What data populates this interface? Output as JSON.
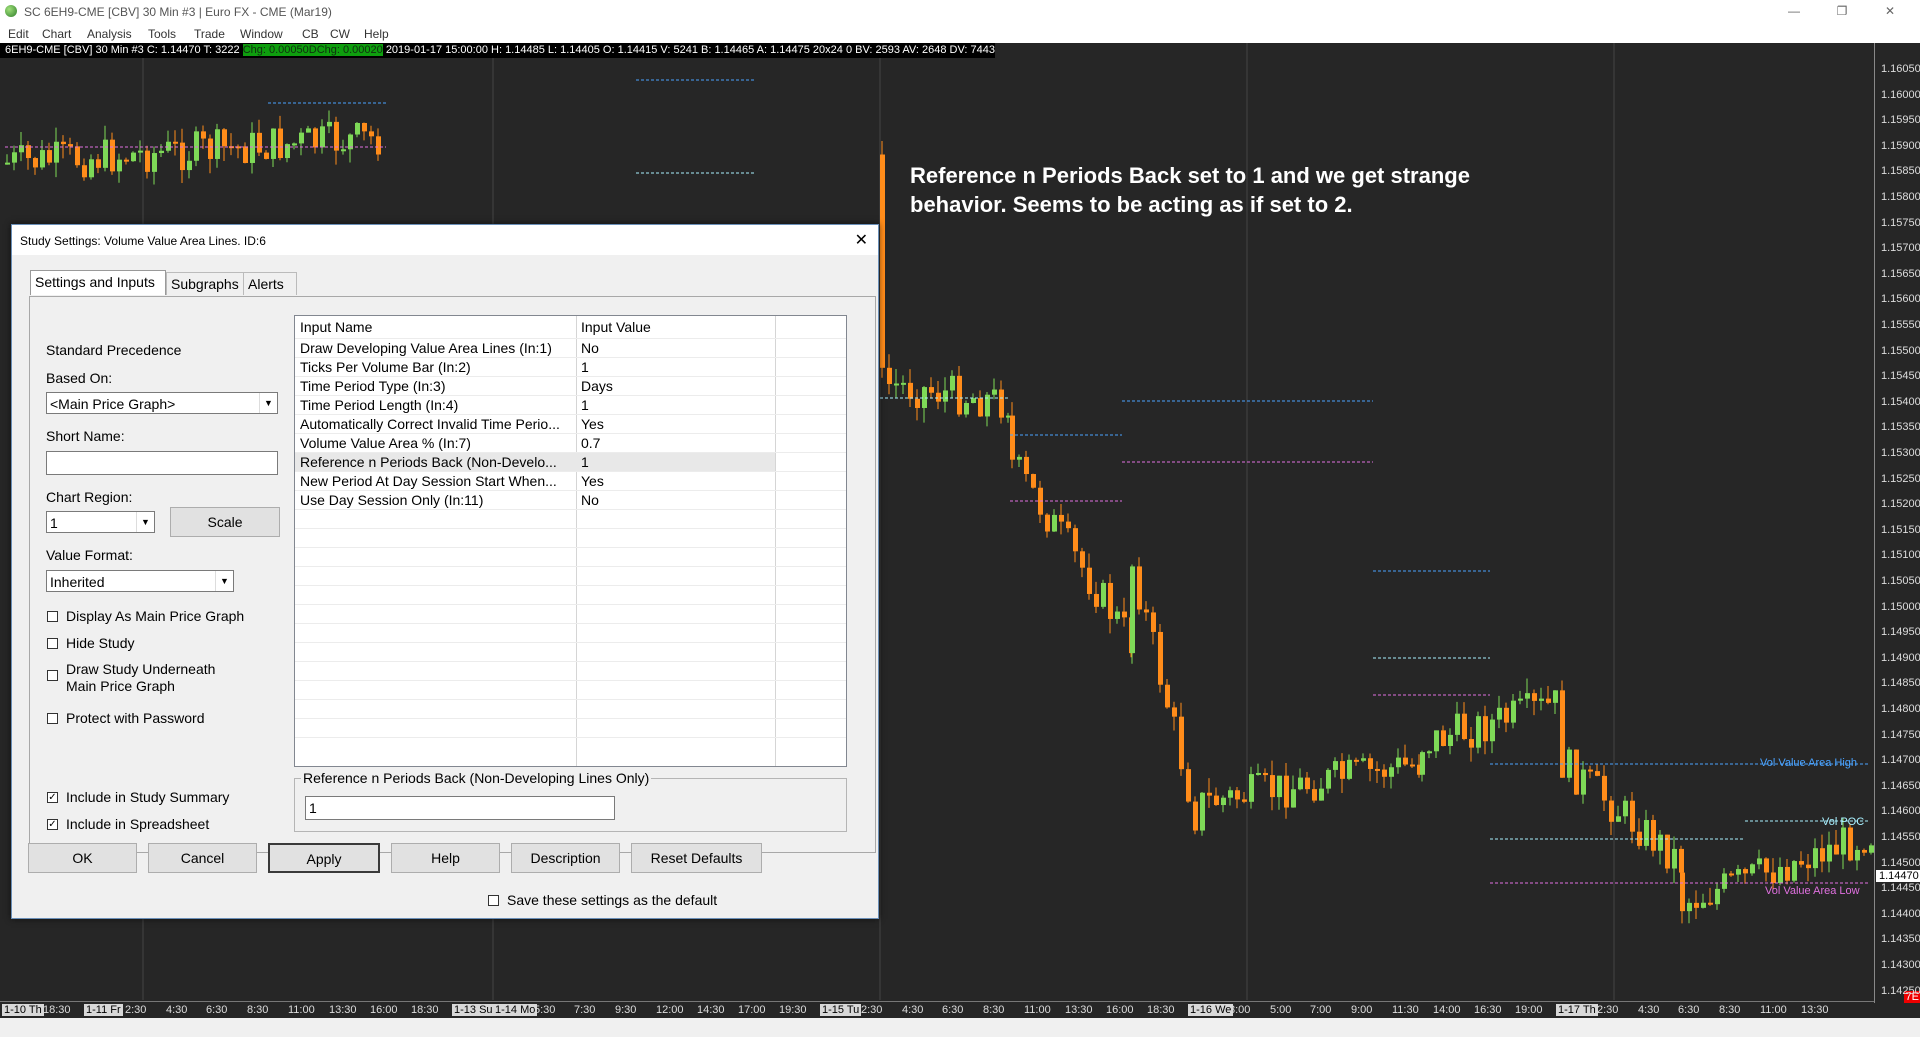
{
  "window": {
    "title": "SC 6EH9-CME [CBV]  30 Min   #3 | Euro FX - CME (Mar19)",
    "minimize": "—",
    "restore": "❐",
    "close": "✕"
  },
  "menu": [
    "Edit",
    "Chart",
    "Analysis",
    "Tools",
    "Trade",
    "Window",
    "CB",
    "CW",
    "Help"
  ],
  "infobar": {
    "symbol": "6EH9-CME [CBV]  30 Min   #3",
    "close": "C: 1.14470",
    "ticks": "T: 3222",
    "chg": "Chg: 0.00050",
    "dchg": "DChg: 0.00020",
    "details": "2019-01-17 15:00:00 H: 1.14485 L: 1.14405 O: 1.14415 V: 5241 B: 1.14465 A: 1.14475 20x24 0 BV: 2593 AV: 2648 DV: 7443"
  },
  "annotation": {
    "line1": "Reference n Periods Back set to 1 and we get strange",
    "line2": "behavior. Seems to be acting as if set to 2."
  },
  "price_axis": {
    "ticks": [
      "1.16050",
      "1.16000",
      "1.15950",
      "1.15900",
      "1.15850",
      "1.15800",
      "1.15750",
      "1.15700",
      "1.15650",
      "1.15600",
      "1.15550",
      "1.15500",
      "1.15450",
      "1.15400",
      "1.15350",
      "1.15300",
      "1.15250",
      "1.15200",
      "1.15150",
      "1.15100",
      "1.15050",
      "1.15000",
      "1.14950",
      "1.14900",
      "1.14850",
      "1.14800",
      "1.14750",
      "1.14700",
      "1.14650",
      "1.14600",
      "1.14550",
      "1.14500",
      "1.14450",
      "1.14400",
      "1.14350",
      "1.14300",
      "1.14250"
    ],
    "current": "1.14470",
    "badge": "7E"
  },
  "time_axis": [
    {
      "label": "1-10 Th",
      "day": true
    },
    {
      "label": "18:30",
      "day": false
    },
    {
      "label": "1-11 Fr",
      "day": true
    },
    {
      "label": "2:30",
      "day": false
    },
    {
      "label": "4:30",
      "day": false
    },
    {
      "label": "6:30",
      "day": false
    },
    {
      "label": "8:30",
      "day": false
    },
    {
      "label": "11:00",
      "day": false
    },
    {
      "label": "13:30",
      "day": false
    },
    {
      "label": "16:00",
      "day": false
    },
    {
      "label": "18:30",
      "day": false
    },
    {
      "label": "1-13 Su",
      "day": true
    },
    {
      "label": "1-14 Mo",
      "day": true
    },
    {
      "label": "5:30",
      "day": false
    },
    {
      "label": "7:30",
      "day": false
    },
    {
      "label": "9:30",
      "day": false
    },
    {
      "label": "12:00",
      "day": false
    },
    {
      "label": "14:30",
      "day": false
    },
    {
      "label": "17:00",
      "day": false
    },
    {
      "label": "19:30",
      "day": false
    },
    {
      "label": "1-15 Tu",
      "day": true
    },
    {
      "label": "2:30",
      "day": false
    },
    {
      "label": "4:30",
      "day": false
    },
    {
      "label": "6:30",
      "day": false
    },
    {
      "label": "8:30",
      "day": false
    },
    {
      "label": "11:00",
      "day": false
    },
    {
      "label": "13:30",
      "day": false
    },
    {
      "label": "16:00",
      "day": false
    },
    {
      "label": "18:30",
      "day": false
    },
    {
      "label": "1-16 We",
      "day": true
    },
    {
      "label": "3:00",
      "day": false
    },
    {
      "label": "5:00",
      "day": false
    },
    {
      "label": "7:00",
      "day": false
    },
    {
      "label": "9:00",
      "day": false
    },
    {
      "label": "11:30",
      "day": false
    },
    {
      "label": "14:00",
      "day": false
    },
    {
      "label": "16:30",
      "day": false
    },
    {
      "label": "19:00",
      "day": false
    },
    {
      "label": "1-17 Th",
      "day": true
    },
    {
      "label": "2:30",
      "day": false
    },
    {
      "label": "4:30",
      "day": false
    },
    {
      "label": "6:30",
      "day": false
    },
    {
      "label": "8:30",
      "day": false
    },
    {
      "label": "11:00",
      "day": false
    },
    {
      "label": "13:30",
      "day": false
    }
  ],
  "level_labels": {
    "vah": "Vol Value Area High",
    "poc": "Vol POC",
    "val": "Vol Value Area Low"
  },
  "colors": {
    "up": "#7ed957",
    "down": "#ff8c1a",
    "vah": "#4aa3ff",
    "poc": "#a8f0ff",
    "val": "#e070e0"
  },
  "dialog": {
    "title": "Study Settings: Volume Value Area Lines. ID:6",
    "close": "✕",
    "tabs": [
      "Settings and Inputs",
      "Subgraphs",
      "Alerts"
    ],
    "standard_precedence": "Standard Precedence",
    "based_on_label": "Based On:",
    "based_on_value": "<Main Price Graph>",
    "short_name_label": "Short Name:",
    "short_name_value": "",
    "chart_region_label": "Chart Region:",
    "chart_region_value": "1",
    "scale_button": "Scale",
    "value_format_label": "Value Format:",
    "value_format_value": "Inherited",
    "checkboxes": [
      {
        "label": "Display As Main Price Graph",
        "checked": false
      },
      {
        "label": "Hide Study",
        "checked": false
      },
      {
        "label": "Draw Study Underneath",
        "label2": "Main Price Graph",
        "checked": false
      },
      {
        "label": "Protect with Password",
        "checked": false
      }
    ],
    "include_summary": "Include in Study Summary",
    "include_spreadsheet": "Include in Spreadsheet",
    "grid": {
      "headers": [
        "Input Name",
        "Input Value"
      ],
      "rows": [
        {
          "name": "Draw Developing Value Area Lines   (In:1)",
          "value": "No"
        },
        {
          "name": "Ticks Per Volume Bar   (In:2)",
          "value": "1"
        },
        {
          "name": "Time Period Type   (In:3)",
          "value": "Days"
        },
        {
          "name": "Time Period Length   (In:4)",
          "value": "1"
        },
        {
          "name": "Automatically Correct Invalid Time Perio...",
          "value": "Yes"
        },
        {
          "name": "Volume Value Area %   (In:7)",
          "value": "0.7"
        },
        {
          "name": "Reference n Periods Back (Non-Develo...",
          "value": "1"
        },
        {
          "name": "New Period At Day Session Start When...",
          "value": "Yes"
        },
        {
          "name": "Use Day Session Only   (In:11)",
          "value": "No"
        }
      ]
    },
    "edit_group_title": "Reference n Periods Back (Non-Developing Lines Only)",
    "edit_value": "1",
    "buttons": [
      "OK",
      "Cancel",
      "Apply",
      "Help",
      "Description",
      "Reset Defaults"
    ],
    "save_default": "Save these settings as the default"
  }
}
